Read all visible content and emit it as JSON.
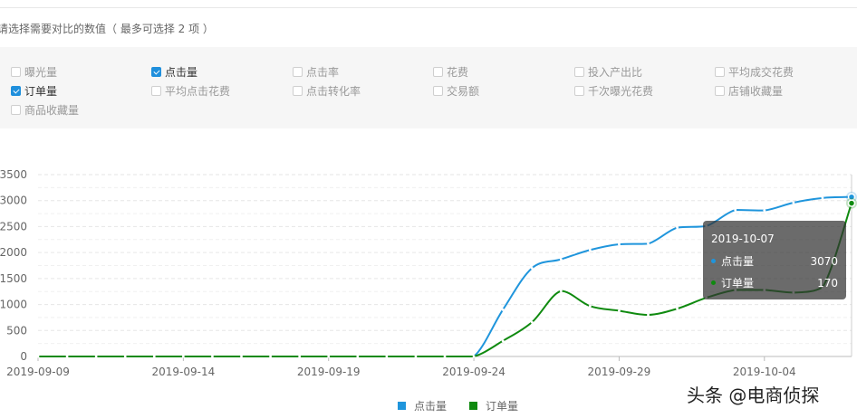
{
  "hint": "请选择需要对比的数值（ 最多可选择 2 项 ）",
  "metrics": [
    {
      "label": "曝光量",
      "checked": false
    },
    {
      "label": "点击量",
      "checked": true
    },
    {
      "label": "点击率",
      "checked": false
    },
    {
      "label": "花费",
      "checked": false
    },
    {
      "label": "投入产出比",
      "checked": false
    },
    {
      "label": "平均成交花费",
      "checked": false
    },
    {
      "label": "订单量",
      "checked": true
    },
    {
      "label": "平均点击花费",
      "checked": false
    },
    {
      "label": "点击转化率",
      "checked": false
    },
    {
      "label": "交易额",
      "checked": false
    },
    {
      "label": "千次曝光花费",
      "checked": false
    },
    {
      "label": "店铺收藏量",
      "checked": false
    },
    {
      "label": "商品收藏量",
      "checked": false
    }
  ],
  "colors": {
    "click": "#1f95dc",
    "order": "#0f8a0f"
  },
  "tooltip": {
    "date": "2019-10-07",
    "rows": [
      {
        "name": "点击量",
        "value": "3070"
      },
      {
        "name": "订单量",
        "value": "170"
      }
    ]
  },
  "watermark": "头条 @电商侦探",
  "chart_data": {
    "type": "line",
    "x": [
      "2019-09-09",
      "2019-09-10",
      "2019-09-11",
      "2019-09-12",
      "2019-09-13",
      "2019-09-14",
      "2019-09-15",
      "2019-09-16",
      "2019-09-17",
      "2019-09-18",
      "2019-09-19",
      "2019-09-20",
      "2019-09-21",
      "2019-09-22",
      "2019-09-23",
      "2019-09-24",
      "2019-09-25",
      "2019-09-26",
      "2019-09-27",
      "2019-09-28",
      "2019-09-29",
      "2019-09-30",
      "2019-10-01",
      "2019-10-02",
      "2019-10-03",
      "2019-10-04",
      "2019-10-05",
      "2019-10-06",
      "2019-10-07"
    ],
    "xticks": [
      "2019-09-09",
      "2019-09-14",
      "2019-09-19",
      "2019-09-24",
      "2019-09-29",
      "2019-10-04"
    ],
    "yticks": [
      0,
      500,
      1000,
      1500,
      2000,
      2500,
      3000,
      3500
    ],
    "ylim": [
      0,
      3500
    ],
    "grid": true,
    "legend": "bottom",
    "series": [
      {
        "name": "点击量",
        "values": [
          0,
          0,
          0,
          0,
          0,
          0,
          0,
          0,
          0,
          0,
          0,
          0,
          0,
          0,
          0,
          0,
          900,
          1700,
          1870,
          2050,
          2160,
          2170,
          2480,
          2510,
          2820,
          2810,
          2960,
          3050,
          3070
        ]
      },
      {
        "name": "订单量",
        "values": [
          0,
          0,
          0,
          0,
          0,
          0,
          0,
          0,
          0,
          0,
          0,
          0,
          0,
          0,
          0,
          0,
          300,
          660,
          1260,
          970,
          880,
          800,
          920,
          1130,
          1280,
          1280,
          1230,
          1330,
          2950
        ]
      }
    ],
    "tooltip_index": 28
  }
}
